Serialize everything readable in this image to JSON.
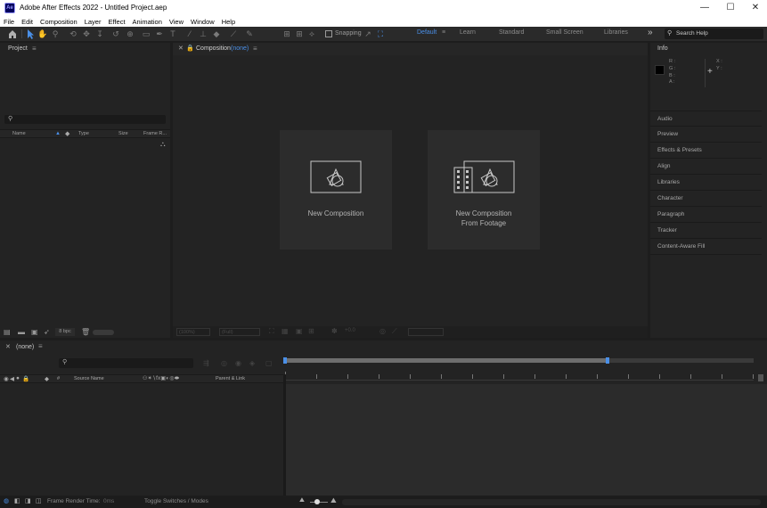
{
  "app": {
    "icon_text": "Ae",
    "title": "Adobe After Effects 2022 - Untitled Project.aep",
    "window_controls": [
      "—",
      "☐",
      "✕"
    ]
  },
  "menu": [
    "File",
    "Edit",
    "Composition",
    "Layer",
    "Effect",
    "Animation",
    "View",
    "Window",
    "Help"
  ],
  "toolbar": {
    "snapping_label": "Snapping",
    "workspaces": [
      "Default",
      "Learn",
      "Standard",
      "Small Screen",
      "Libraries"
    ],
    "active_workspace": "Default",
    "overflow": "»",
    "search_placeholder": "Search Help"
  },
  "project": {
    "title": "Project",
    "columns": [
      "Name",
      "Type",
      "Size",
      "Frame R..."
    ],
    "bpc": "8 bpc"
  },
  "composition": {
    "tab_label": "Composition",
    "tab_value": "(none)",
    "cards": [
      {
        "line1": "New Composition",
        "line2": ""
      },
      {
        "line1": "New Composition",
        "line2": "From Footage"
      }
    ],
    "footer": {
      "zoom": "(100%)",
      "res": "(Full)",
      "exposure": "+0.0"
    }
  },
  "info": {
    "title": "Info",
    "channels": [
      "R :",
      "G :",
      "B :",
      "A :"
    ],
    "coords": [
      "X :",
      "Y :"
    ]
  },
  "right_panels": [
    "Audio",
    "Preview",
    "Effects & Presets",
    "Align",
    "Libraries",
    "Character",
    "Paragraph",
    "Tracker",
    "Content-Aware Fill"
  ],
  "timeline": {
    "tab_label": "(none)",
    "col_source_name": "Source Name",
    "col_parent_link": "Parent & Link"
  },
  "status": {
    "frame_render_label": "Frame Render Time:",
    "frame_render_value": "0ms",
    "toggle_label": "Toggle Switches / Modes"
  },
  "colors": {
    "accent": "#4a8fe7",
    "panel": "#232323",
    "card": "#2c2c2c"
  }
}
